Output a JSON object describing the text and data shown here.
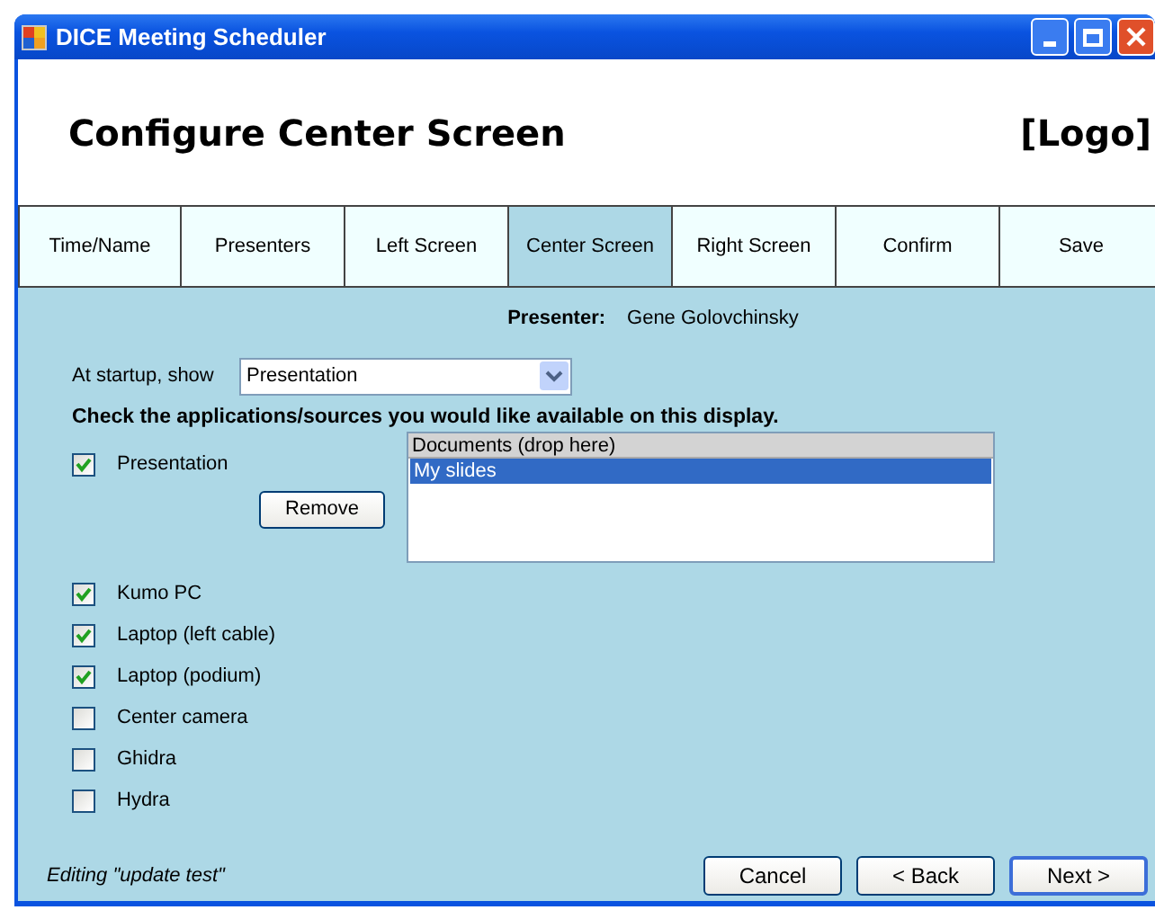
{
  "window": {
    "title": "DICE Meeting Scheduler"
  },
  "header": {
    "title": "Configure Center Screen",
    "logo": "[Logo]"
  },
  "tabs": [
    {
      "label": "Time/Name",
      "selected": false
    },
    {
      "label": "Presenters",
      "selected": false
    },
    {
      "label": "Left Screen",
      "selected": false
    },
    {
      "label": "Center Screen",
      "selected": true
    },
    {
      "label": "Right Screen",
      "selected": false
    },
    {
      "label": "Confirm",
      "selected": false
    },
    {
      "label": "Save",
      "selected": false
    }
  ],
  "presenter": {
    "label": "Presenter:",
    "name": "Gene Golovchinsky"
  },
  "startup": {
    "label": "At startup, show",
    "value": "Presentation"
  },
  "instruction": "Check the applications/sources you would like available on this display.",
  "sources": [
    {
      "label": "Presentation",
      "checked": true
    },
    {
      "label": "Kumo PC",
      "checked": true
    },
    {
      "label": "Laptop (left cable)",
      "checked": true
    },
    {
      "label": "Laptop (podium)",
      "checked": true
    },
    {
      "label": "Center camera",
      "checked": false
    },
    {
      "label": "Ghidra",
      "checked": false
    },
    {
      "label": "Hydra",
      "checked": false
    }
  ],
  "documents": {
    "header": "Documents (drop here)",
    "remove_button": "Remove",
    "items": [
      {
        "label": "My slides",
        "selected": true
      }
    ]
  },
  "status": "Editing \"update test\"",
  "buttons": [
    {
      "label": "Cancel",
      "default": false
    },
    {
      "label": "< Back",
      "default": false
    },
    {
      "label": "Next >",
      "default": true
    }
  ]
}
